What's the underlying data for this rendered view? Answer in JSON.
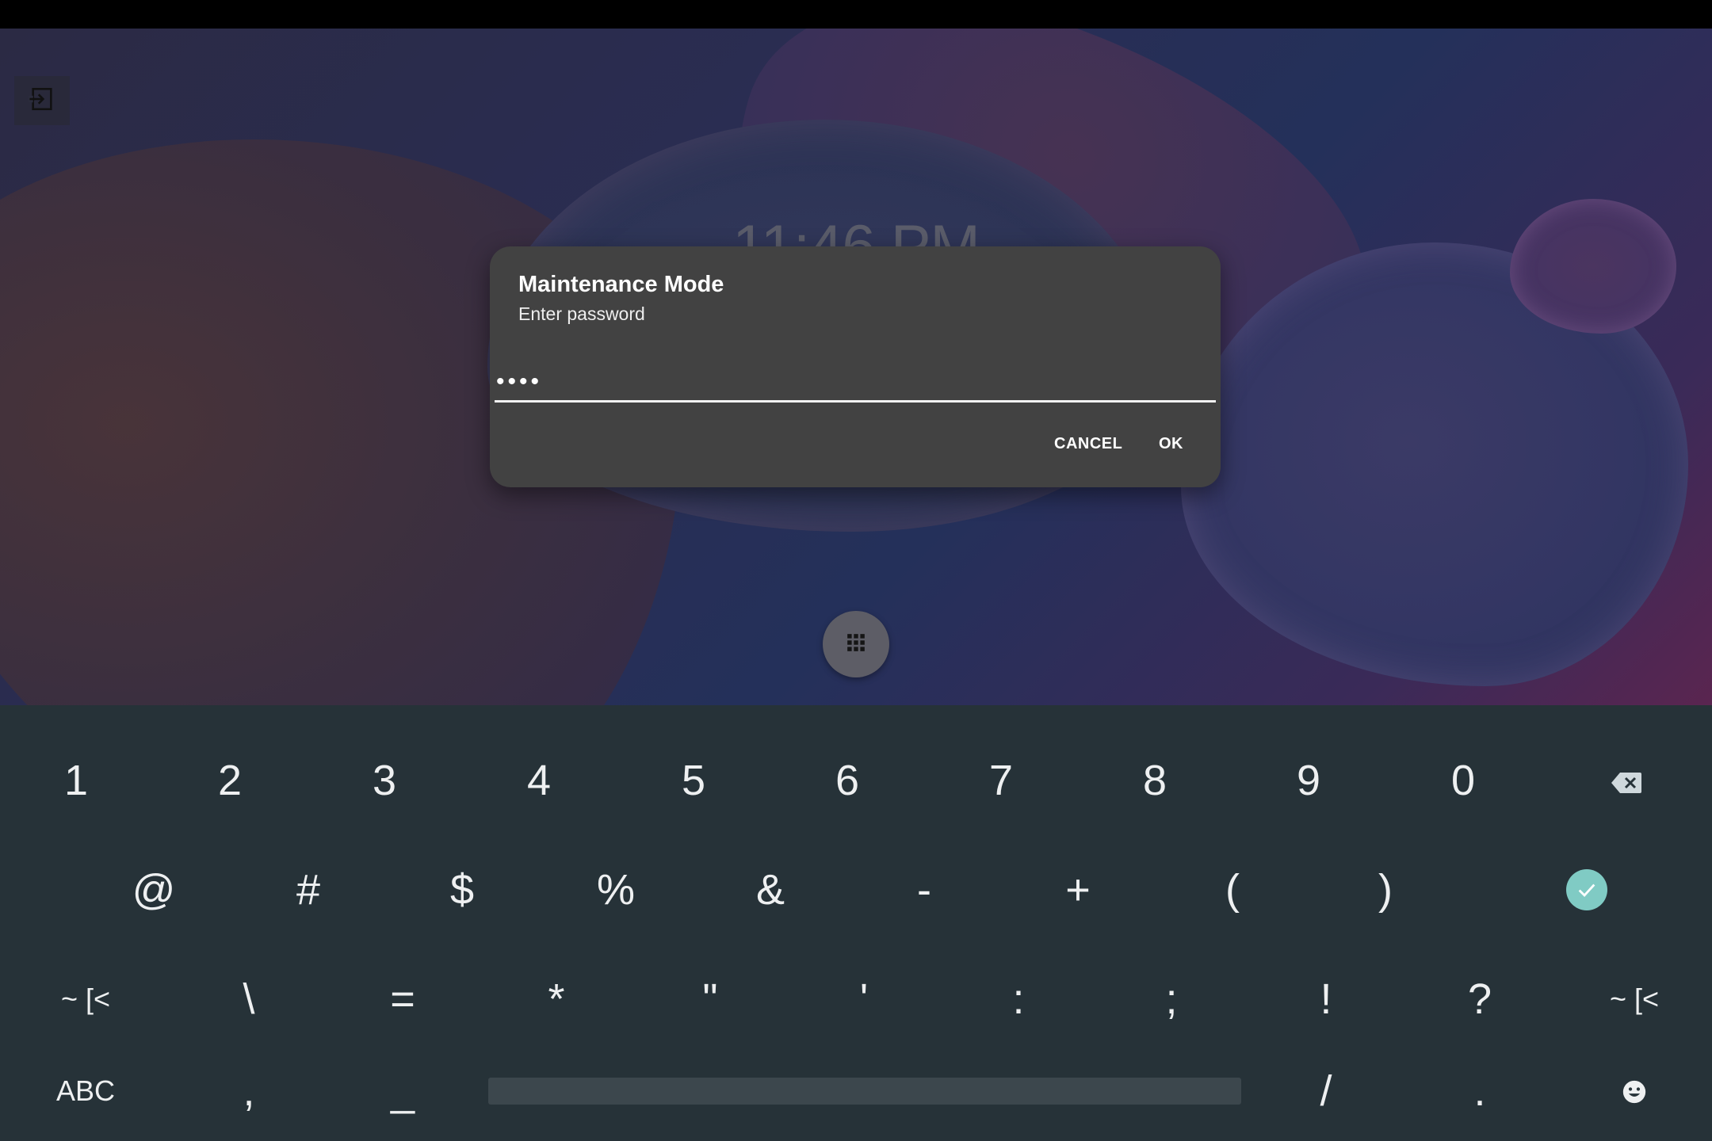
{
  "lockscreen": {
    "clock": "11:46 PM",
    "exit_icon": "exit-to-app-icon",
    "app_drawer_icon": "grid-icon"
  },
  "dialog": {
    "title": "Maintenance Mode",
    "message": "Enter password",
    "password_masked": "••••",
    "cancel_label": "CANCEL",
    "ok_label": "OK"
  },
  "keyboard": {
    "row1": [
      "1",
      "2",
      "3",
      "4",
      "5",
      "6",
      "7",
      "8",
      "9",
      "0"
    ],
    "backspace_icon": "backspace-icon",
    "row2": [
      "@",
      "#",
      "$",
      "%",
      "&",
      "-",
      "+",
      "(",
      ")"
    ],
    "enter_icon": "check-icon",
    "enter_color": "#80cbc4",
    "row3_left": "~ [<",
    "row3": [
      "\\",
      "=",
      "*",
      "\"",
      "'",
      ":",
      ";",
      "!",
      "?"
    ],
    "row3_right": "~ [<",
    "row4_left": "ABC",
    "row4_comma": ",",
    "row4_underscore": "_",
    "row4_slash": "/",
    "row4_period": ".",
    "emoji_icon": "emoji-icon"
  },
  "colors": {
    "dialog_bg": "#424242",
    "keyboard_bg": "#263238",
    "key_text": "#eef0f1"
  }
}
